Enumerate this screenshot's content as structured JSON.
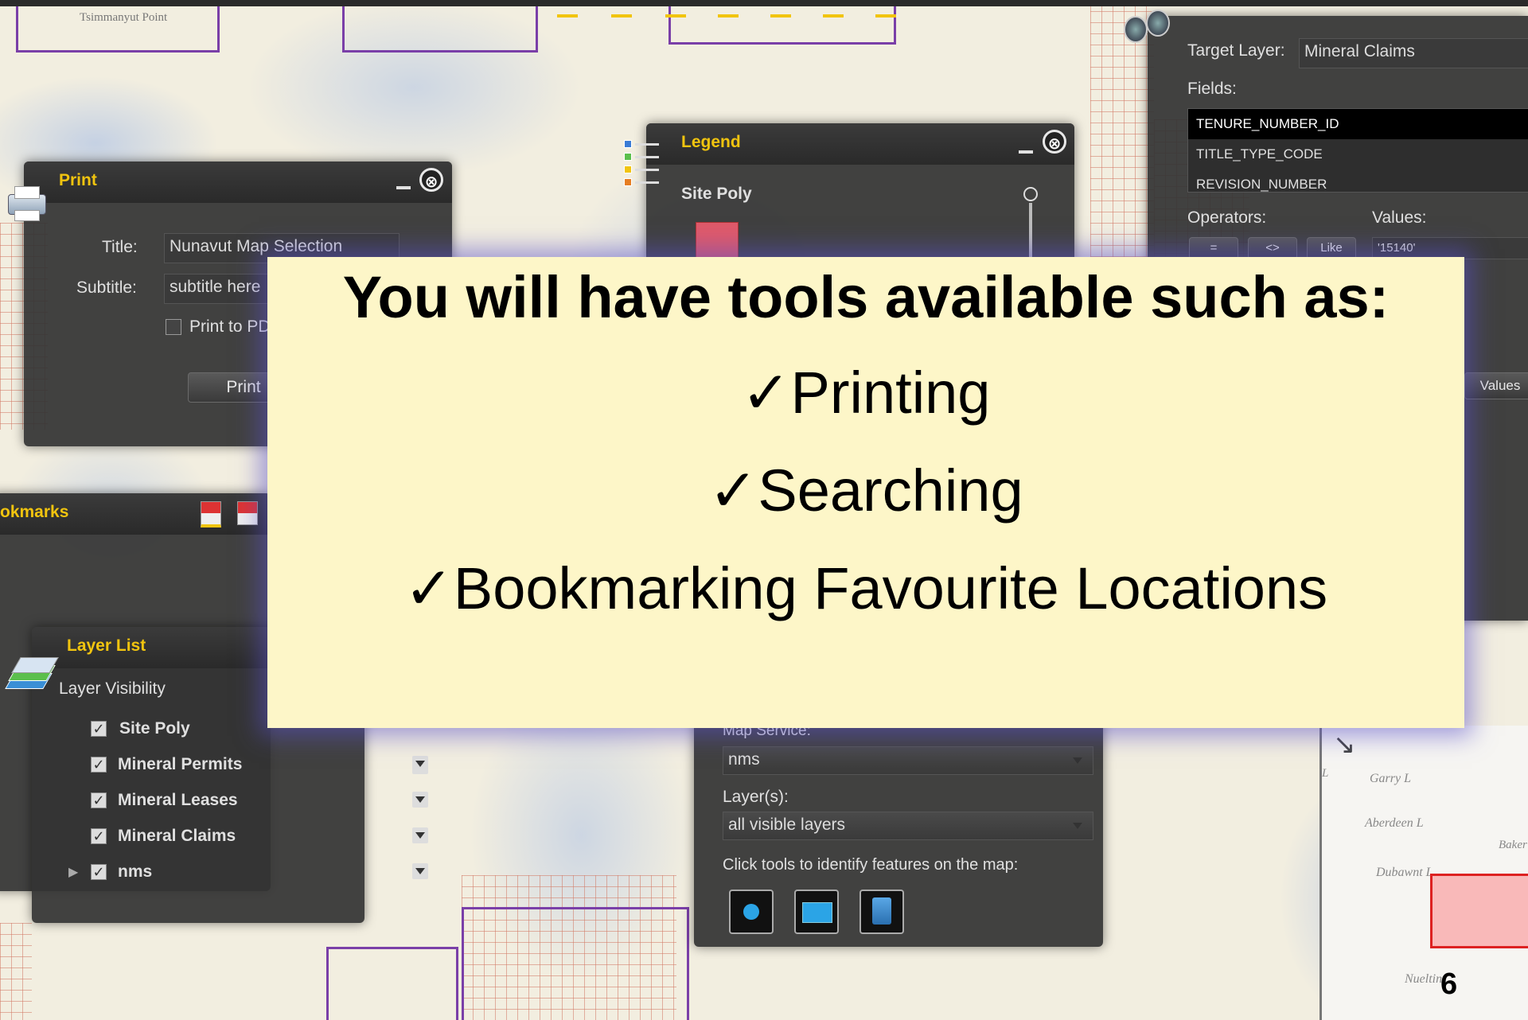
{
  "map": {
    "top_label": "Tsimmanyut Point",
    "place_labels": [
      "Garry L",
      "Aberdeen L",
      "Dubawnt L",
      "Baker",
      "Nueltin",
      "L"
    ]
  },
  "print_panel": {
    "title": "Print",
    "title_label": "Title:",
    "title_value": "Nunavut Map Selection",
    "subtitle_label": "Subtitle:",
    "subtitle_value": "subtitle here",
    "pdf_label": "Print to PD",
    "print_button": "Print",
    "close_glyph": "⊗"
  },
  "legend_panel": {
    "title": "Legend",
    "site_poly": "Site Poly",
    "swatch_color": "#e05a6a"
  },
  "bookmarks_panel": {
    "title": "okmarks"
  },
  "layer_list_panel": {
    "title": "Layer List",
    "subtitle": "Layer Visibility",
    "layers": [
      {
        "name": "Site Poly",
        "checked": true
      },
      {
        "name": "Mineral Permits",
        "checked": true
      },
      {
        "name": "Mineral Leases",
        "checked": true
      },
      {
        "name": "Mineral Claims",
        "checked": true
      },
      {
        "name": "nms",
        "checked": true
      }
    ]
  },
  "query_panel": {
    "target_layer_label": "Target Layer:",
    "target_layer_value": "Mineral Claims",
    "fields_label": "Fields:",
    "fields": [
      "TENURE_NUMBER_ID",
      "TITLE_TYPE_CODE",
      "REVISION_NUMBER"
    ],
    "operators_label": "Operators:",
    "values_label": "Values:",
    "operators": [
      "=",
      "<>",
      "Like"
    ],
    "value_sample": "'15140'",
    "values_button": "Values"
  },
  "identify_panel": {
    "map_service_label": "Map Service:",
    "map_service_value": "nms",
    "layers_label": "Layer(s):",
    "layers_value": "all visible layers",
    "instruction": "Click tools to identify features on the map:"
  },
  "overlay": {
    "title": "You will have tools available such as:",
    "items": [
      "✓Printing",
      "✓Searching",
      "✓Bookmarking Favourite Locations"
    ]
  },
  "page_number": "6"
}
